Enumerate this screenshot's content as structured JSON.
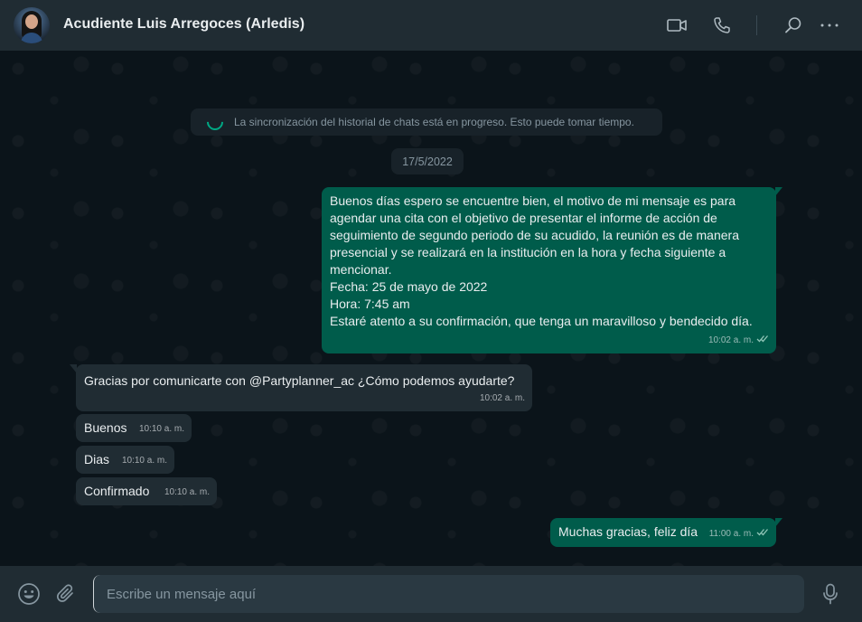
{
  "header": {
    "contact_name": "Acudiente Luis Arregoces (Arledis)",
    "icons": [
      "video-call-icon",
      "voice-call-icon",
      "search-icon",
      "menu-icon"
    ]
  },
  "chat": {
    "sync_notice": "La sincronización del historial de chats está en progreso. Esto puede tomar tiempo.",
    "date_chip": "17/5/2022",
    "messages": [
      {
        "direction": "outgoing",
        "text": "Buenos días espero se encuentre bien, el motivo de mi mensaje es para agendar una cita con el objetivo de presentar el informe de acción de seguimiento de segundo periodo de su acudido, la reunión es de manera presencial y se realizará en la institución en la hora y fecha siguiente a mencionar.\nFecha: 25 de mayo de 2022\nHora: 7:45 am\nEstaré atento a su confirmación, que tenga un maravilloso y bendecido día.",
        "time": "10:02 a. m.",
        "status": "read"
      },
      {
        "direction": "incoming",
        "text": "Gracias por comunicarte con  @Partyplanner_ac ¿Cómo podemos ayudarte?",
        "time": "10:02 a. m."
      },
      {
        "direction": "incoming",
        "text": "Buenos",
        "time": "10:10 a. m."
      },
      {
        "direction": "incoming",
        "text": "Dias",
        "time": "10:10 a. m."
      },
      {
        "direction": "incoming",
        "text": "Confirmado",
        "time": "10:10 a. m."
      },
      {
        "direction": "outgoing",
        "text": "Muchas gracias, feliz día",
        "time": "11:00 a. m.",
        "status": "read"
      }
    ]
  },
  "composer": {
    "placeholder": "Escribe un mensaje aquí",
    "value": "",
    "icons": [
      "emoji-icon",
      "attach-icon",
      "microphone-icon"
    ]
  },
  "colors": {
    "header_bg": "#202c33",
    "chat_bg": "#0b141a",
    "outgoing_bubble": "#005c4b",
    "incoming_bubble": "#202c33",
    "accent": "#00a884",
    "read_ticks": "#8fc5b7"
  }
}
